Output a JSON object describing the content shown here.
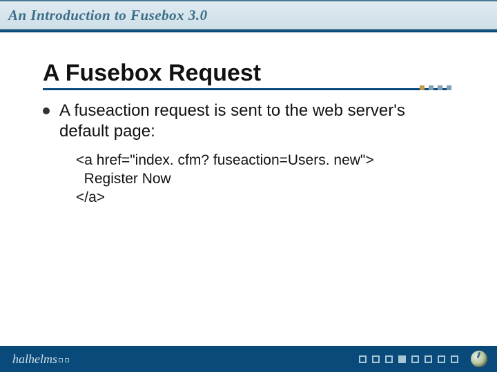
{
  "header": {
    "title": "An Introduction to Fusebox 3.0"
  },
  "slide": {
    "title": "A Fusebox Request",
    "bullet": "A fuseaction request is sent to the web server's default page:",
    "code": "<a href=\"index. cfm? fuseaction=Users. new\">\n  Register Now\n</a>"
  },
  "footer": {
    "brand": "halhelms"
  }
}
